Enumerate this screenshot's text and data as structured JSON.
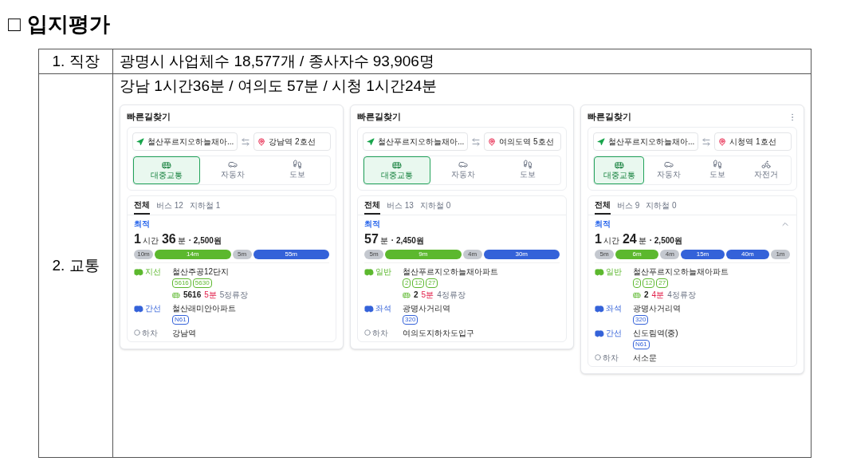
{
  "heading": {
    "mark": "□",
    "title": "입지평가"
  },
  "rows": [
    {
      "label": "1. 직장",
      "text": "광명시 사업체수 18,577개 / 종사자수 93,906명"
    },
    {
      "label": "2. 교통",
      "text": "강남 1시간36분 / 여의도 57분 / 시청 1시간24분",
      "screens": [
        {
          "title": "빠른길찾기",
          "origin": "철산푸르지오하늘채아...",
          "destination": "강남역 2호선",
          "modes": [
            {
              "kind": "transit",
              "label": "대중교통",
              "selected": true
            },
            {
              "kind": "car",
              "label": "자동차",
              "selected": false
            },
            {
              "kind": "walk",
              "label": "도보",
              "selected": false
            }
          ],
          "tabs": [
            {
              "label": "전체",
              "selected": true
            },
            {
              "label": "버스 12",
              "selected": false
            },
            {
              "label": "지하철 1",
              "selected": false
            }
          ],
          "badge": "최적",
          "duration": [
            {
              "value": "1",
              "unit": "시간"
            },
            {
              "value": "36",
              "unit": "분"
            }
          ],
          "fare": "· 2,500원",
          "segments": [
            {
              "kind": "walk",
              "label": "10m",
              "color": "#c4c8cf"
            },
            {
              "kind": "bus",
              "label": "14m",
              "color": "#5cb82e"
            },
            {
              "kind": "walk",
              "label": "5m",
              "color": "#c4c8cf"
            },
            {
              "kind": "bus",
              "label": "55m",
              "color": "#3462d9"
            }
          ],
          "steps": [
            {
              "kind": "bus",
              "type": "지선",
              "color": "#5cb82e",
              "stop": "철산주공12단지",
              "routes": [
                "5616",
                "5630"
              ],
              "info": {
                "bus": "5616",
                "wait": "5분",
                "stops": "5정류장"
              }
            },
            {
              "kind": "bus",
              "type": "간선",
              "color": "#3462d9",
              "stop": "철산래미안아파트",
              "routes": [
                "N61"
              ]
            },
            {
              "kind": "alight",
              "type": "하차",
              "stop": "강남역"
            }
          ]
        },
        {
          "title": "빠른길찾기",
          "origin": "철산푸르지오하늘채아...",
          "destination": "여의도역 5호선",
          "modes": [
            {
              "kind": "transit",
              "label": "대중교통",
              "selected": true
            },
            {
              "kind": "car",
              "label": "자동차",
              "selected": false
            },
            {
              "kind": "walk",
              "label": "도보",
              "selected": false
            }
          ],
          "tabs": [
            {
              "label": "전체",
              "selected": true
            },
            {
              "label": "버스 13",
              "selected": false
            },
            {
              "label": "지하철 0",
              "selected": false
            }
          ],
          "badge": "최적",
          "duration": [
            {
              "value": "57",
              "unit": "분"
            }
          ],
          "fare": "· 2,450원",
          "segments": [
            {
              "kind": "walk",
              "label": "5m",
              "color": "#c4c8cf"
            },
            {
              "kind": "bus",
              "label": "9m",
              "color": "#5cb82e"
            },
            {
              "kind": "walk",
              "label": "4m",
              "color": "#c4c8cf"
            },
            {
              "kind": "bus",
              "label": "30m",
              "color": "#3462d9"
            }
          ],
          "steps": [
            {
              "kind": "bus",
              "type": "일반",
              "color": "#5cb82e",
              "stop": "철산푸르지오하늘채아파트",
              "routes": [
                "2",
                "12",
                "27"
              ],
              "info": {
                "bus": "2",
                "wait": "5분",
                "stops": "4정류장"
              }
            },
            {
              "kind": "bus",
              "type": "좌석",
              "color": "#3462d9",
              "stop": "광명사거리역",
              "routes": [
                "320"
              ]
            },
            {
              "kind": "alight",
              "type": "하차",
              "stop": "여의도지하차도입구"
            }
          ]
        },
        {
          "title": "빠른길찾기",
          "menu": true,
          "origin": "철산푸르지오하늘채아...",
          "destination": "시청역 1호선",
          "modes": [
            {
              "kind": "transit",
              "label": "대중교통",
              "selected": true
            },
            {
              "kind": "car",
              "label": "자동차",
              "selected": false
            },
            {
              "kind": "walk",
              "label": "도보",
              "selected": false
            },
            {
              "kind": "bike",
              "label": "자전거",
              "selected": false
            }
          ],
          "tabs": [
            {
              "label": "전체",
              "selected": true
            },
            {
              "label": "버스 9",
              "selected": false
            },
            {
              "label": "지하철 0",
              "selected": false
            }
          ],
          "badge": "최적",
          "chevron": true,
          "duration": [
            {
              "value": "1",
              "unit": "시간"
            },
            {
              "value": "24",
              "unit": "분"
            }
          ],
          "fare": "· 2,500원",
          "segments": [
            {
              "kind": "walk",
              "label": "5m",
              "color": "#c4c8cf"
            },
            {
              "kind": "bus",
              "label": "6m",
              "color": "#5cb82e"
            },
            {
              "kind": "walk",
              "label": "4m",
              "color": "#c4c8cf"
            },
            {
              "kind": "bus",
              "label": "15m",
              "color": "#3462d9"
            },
            {
              "kind": "bus",
              "label": "40m",
              "color": "#3462d9"
            },
            {
              "kind": "walk",
              "label": "1m",
              "color": "#c4c8cf"
            }
          ],
          "steps": [
            {
              "kind": "bus",
              "type": "일반",
              "color": "#5cb82e",
              "stop": "철산푸르지오하늘채아파트",
              "routes": [
                "2",
                "12",
                "27"
              ],
              "info": {
                "bus": "2",
                "wait": "4분",
                "stops": "4정류장"
              }
            },
            {
              "kind": "bus",
              "type": "좌석",
              "color": "#3462d9",
              "stop": "광명사거리역",
              "routes": [
                "320"
              ]
            },
            {
              "kind": "bus",
              "type": "간선",
              "color": "#3462d9",
              "stop": "신도림역(중)",
              "routes": [
                "N61"
              ]
            },
            {
              "kind": "alight",
              "type": "하차",
              "stop": "서소문"
            }
          ]
        }
      ]
    }
  ]
}
